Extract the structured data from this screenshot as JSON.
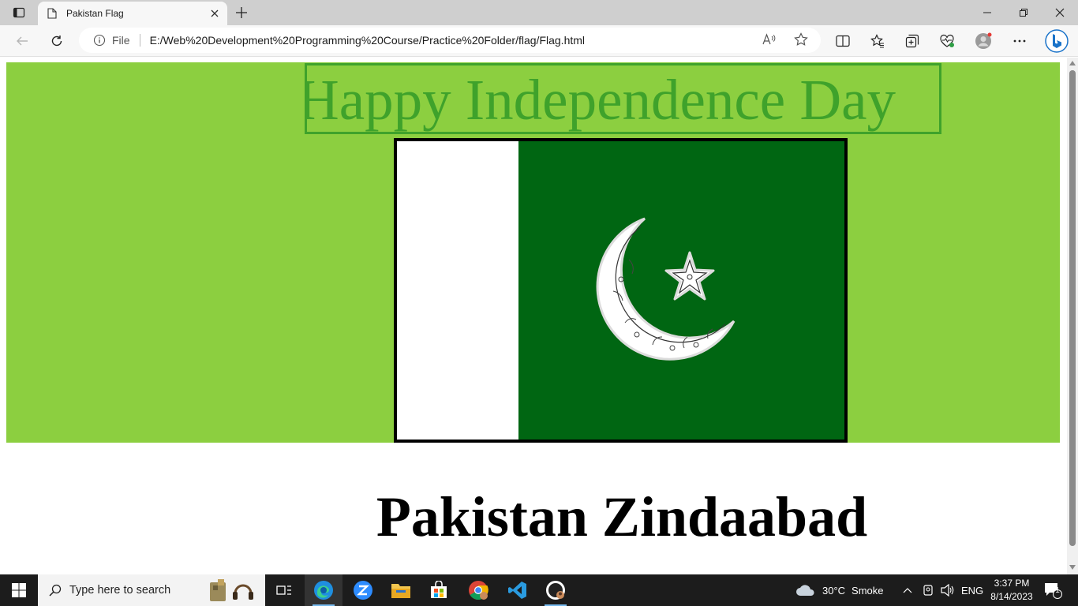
{
  "browser": {
    "tab_title": "Pakistan Flag",
    "address_scheme": "File",
    "address_url": "E:/Web%20Development%20Programming%20Course/Practice%20Folder/flag/Flag.html"
  },
  "page": {
    "heading": "Happy Independence Day",
    "footer_text": "Pakistan Zindaabad",
    "colors": {
      "background": "#8ccf40",
      "heading": "#3fa22b",
      "flag_green": "#006612",
      "flag_white": "#ffffff"
    }
  },
  "taskbar": {
    "search_placeholder": "Type here to search",
    "weather_temp": "30°C",
    "weather_desc": "Smoke",
    "language": "ENG",
    "time": "3:37 PM",
    "date": "8/14/2023",
    "notification_count": "1"
  }
}
